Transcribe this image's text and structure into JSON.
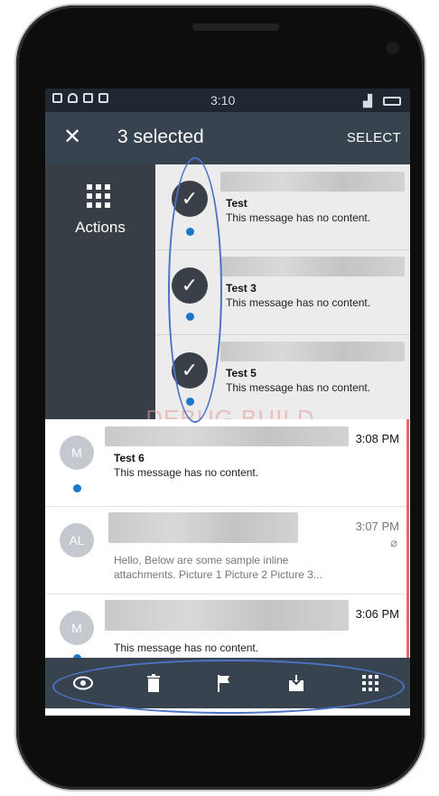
{
  "status_bar": {
    "time": "3:10"
  },
  "app_bar": {
    "close_icon": "close-icon",
    "title": "3 selected",
    "select_label": "SELECT"
  },
  "actions_panel": {
    "label": "Actions",
    "icon": "grid-icon"
  },
  "selected_messages": [
    {
      "subject": "Test",
      "preview": "This message has no content."
    },
    {
      "subject": "Test 3",
      "preview": "This message has no content."
    },
    {
      "subject": "Test 5",
      "preview": "This message has no content."
    }
  ],
  "messages": [
    {
      "avatar": "M",
      "time": "3:08 PM",
      "subject": "Test 6",
      "preview": "This message has no content."
    },
    {
      "avatar": "AL",
      "time": "3:07 PM",
      "preview_line1": "Hello, Below are some sample inline",
      "preview_line2": "attachments. Picture 1 Picture 2 Picture 3..."
    },
    {
      "avatar": "M",
      "time": "3:06 PM",
      "preview": "This message has no content."
    }
  ],
  "watermark": "DEBUG BUILD",
  "bottom_toolbar": [
    "eye-icon",
    "trash-icon",
    "flag-icon",
    "archive-icon",
    "grid-icon"
  ],
  "colors": {
    "app_bar": "#37444f",
    "status_bar": "#1f2830",
    "accent_dot": "#1b77c9",
    "annotation": "#4c73c6"
  }
}
